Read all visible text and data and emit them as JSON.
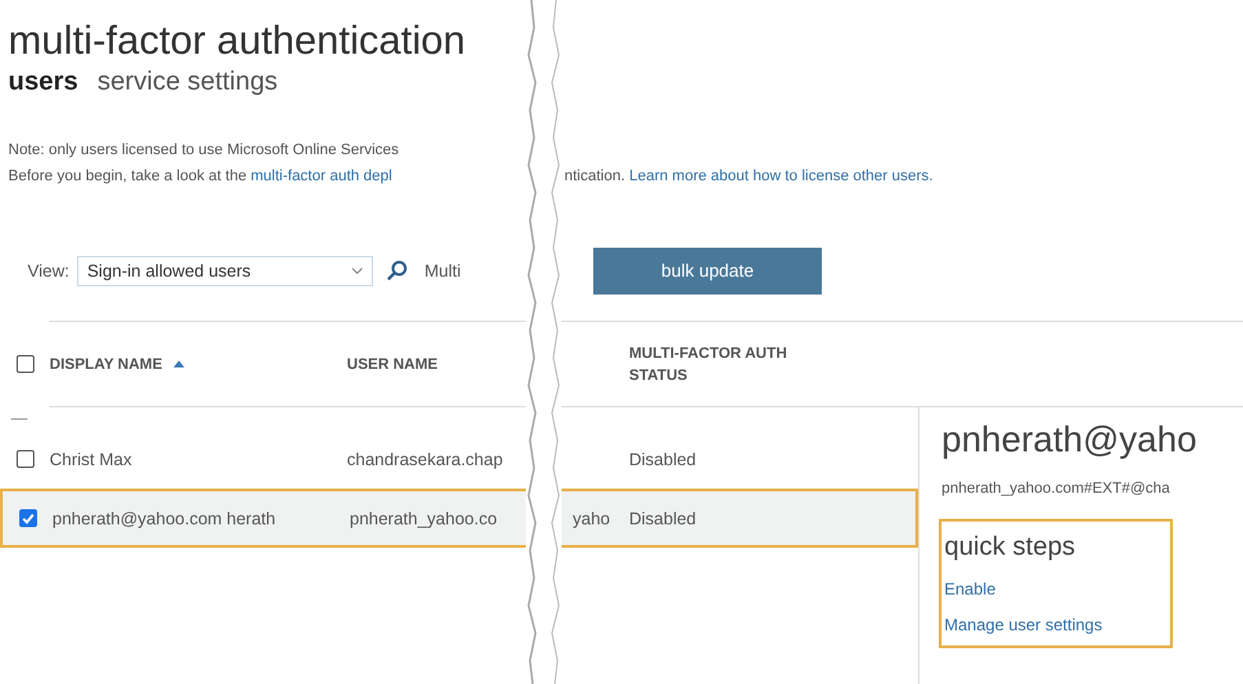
{
  "title": "multi-factor authentication",
  "tabs": [
    {
      "label": "users",
      "selected": true
    },
    {
      "label": "service settings",
      "selected": false
    }
  ],
  "note": {
    "left_lines": [
      {
        "text": "Note: only users licensed to use Microsoft Online Services"
      },
      {
        "text": "Before you begin, take a look at the",
        "link": "multi-factor auth depl"
      }
    ],
    "right_text": "ntication.",
    "right_link": "Learn more about how to license other users."
  },
  "view": {
    "label": "View:",
    "value": "Sign-in allowed users"
  },
  "toolbar_text": "Multi",
  "bulk_button": "bulk update",
  "table": {
    "select_all": false,
    "columns": [
      {
        "label": "DISPLAY NAME",
        "sorted": true
      },
      {
        "label": "USER NAME",
        "sorted": false
      },
      {
        "label": "MULTI-FACTOR AUTH STATUS",
        "sorted": false
      }
    ],
    "rows": [
      {
        "display_name": "Christ Max",
        "user_name_left": "chandrasekara.chap",
        "status": "Disabled",
        "selected": false,
        "highlighted": false
      },
      {
        "display_name": "pnherath@yahoo.com herath",
        "user_name_left": "pnherath_yahoo.co",
        "user_name_right": "yaho",
        "status": "Disabled",
        "selected": true,
        "highlighted": true
      }
    ]
  },
  "details": {
    "name": "pnherath@yaho",
    "upn": "pnherath_yahoo.com#EXT#@cha",
    "quick_steps": {
      "title": "quick steps",
      "highlighted": true,
      "links": [
        "Enable",
        "Manage user settings"
      ]
    }
  }
}
